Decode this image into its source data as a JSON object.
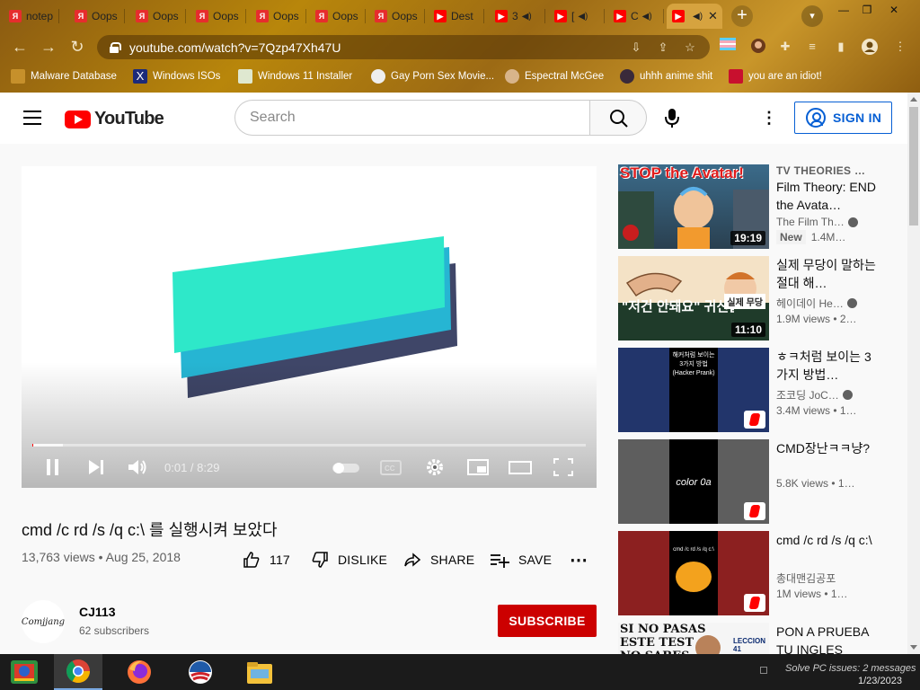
{
  "browser": {
    "tabs": [
      {
        "label": "notep",
        "favicon": "yandex-icon"
      },
      {
        "label": "Oops",
        "favicon": "yandex-icon"
      },
      {
        "label": "Oops",
        "favicon": "yandex-icon"
      },
      {
        "label": "Oops",
        "favicon": "yandex-icon"
      },
      {
        "label": "Oops",
        "favicon": "yandex-icon"
      },
      {
        "label": "Oops",
        "favicon": "yandex-icon"
      },
      {
        "label": "Oops",
        "favicon": "yandex-icon"
      },
      {
        "label": "Dest",
        "favicon": "youtube-icon"
      },
      {
        "label": "3",
        "favicon": "youtube-icon"
      },
      {
        "label": "[",
        "favicon": "youtube-icon"
      },
      {
        "label": "C",
        "favicon": "youtube-icon"
      },
      {
        "label": "",
        "favicon": "youtube-icon"
      }
    ],
    "new_tab": "+",
    "url": "youtube.com/watch?v=7Qzp47Xh47U",
    "bookmarks": [
      "Malware Database",
      "Windows ISOs",
      "Windows 11 Installer",
      "Gay Porn Sex Movie...",
      "Espectral McGee",
      "uhhh anime shit",
      "you are an idiot!"
    ],
    "theme_color": "#b8860b"
  },
  "masthead": {
    "logo_text": "YouTube",
    "search_placeholder": "Search",
    "sign_in": "SIGN IN"
  },
  "player": {
    "time": "0:01 / 8:29",
    "progress_played": 0.002,
    "progress_loaded": 0.055
  },
  "video": {
    "title": "cmd /c rd /s /q c:\\ 를 실행시켜 보았다",
    "meta": "13,763 views • Aug 25, 2018",
    "likes": "117",
    "dislike": "DISLIKE",
    "share": "SHARE",
    "save": "SAVE"
  },
  "channel": {
    "avatar_text": "Comjjang",
    "name": "CJ113",
    "subs": "62 subscribers",
    "subscribe": "SUBSCRIBE"
  },
  "recommendations": [
    {
      "kicker": "TV THEORIES  …",
      "title": "Film Theory: END the Avata…",
      "channel": "The Film Th…",
      "verified": true,
      "badge": "New",
      "stats": "1.4M…",
      "duration": "19:19",
      "thumb_text": "STOP the Avatar!"
    },
    {
      "kicker": "",
      "title": "실제 무당이 말하는 절대 해…",
      "channel": "헤이데이 He…",
      "verified": true,
      "badge": "",
      "stats": "1.9M views  • 2…",
      "duration": "11:10",
      "thumb_text": "\"저건 안돼요\" 귀신을 부르는",
      "thumb_tag": "실제 무당"
    },
    {
      "kicker": "",
      "title": "ㅎㅋ처럼 보이는 3가지 방법…",
      "channel": "조코딩 JoC…",
      "verified": true,
      "badge": "",
      "stats": "3.4M views  • 1…",
      "duration": "",
      "thumb_text": "해커처럼 보이는 3가지 방법 (Hacker Prank)"
    },
    {
      "kicker": "",
      "title": "CMD장난ㅋㅋ냥?",
      "channel": "",
      "verified": false,
      "badge": "",
      "stats": "5.8K views  • 1…",
      "duration": "",
      "thumb_text": "color 0a"
    },
    {
      "kicker": "",
      "title": "cmd /c rd /s /q c:\\",
      "channel": "총대맨김공포",
      "verified": false,
      "badge": "",
      "stats": "1M views  • 1…",
      "duration": "",
      "thumb_text": "cmd /c rd /s /q c:\\"
    },
    {
      "kicker": "",
      "title": "PON A PRUEBA TU INGLES",
      "channel": "",
      "verified": false,
      "badge": "",
      "stats": "",
      "duration": "",
      "thumb_text": "SI NO PASAS ESTE TEST NO SABES",
      "thumb_tag": "LECCION 41"
    }
  ],
  "taskbar": {
    "apps": [
      "control-panel-icon",
      "chrome-icon",
      "firefox-icon",
      "obama-icon",
      "file-explorer-icon"
    ],
    "tray_message": "Solve PC issues: 2 messages",
    "date": "1/23/2023"
  }
}
